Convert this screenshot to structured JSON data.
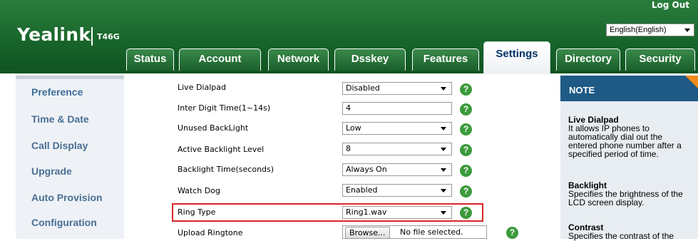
{
  "header": {
    "logo": "Yealink",
    "model": "T46G",
    "logout": "Log Out",
    "language": "English(English)"
  },
  "tabs": [
    "Status",
    "Account",
    "Network",
    "Dsskey",
    "Features",
    "Settings",
    "Directory",
    "Security"
  ],
  "active_tab": "Settings",
  "sidebar": {
    "items": [
      "Preference",
      "Time & Date",
      "Call Display",
      "Upgrade",
      "Auto Provision",
      "Configuration"
    ],
    "active": "Preference"
  },
  "settings": {
    "live_dialpad": {
      "label": "Live Dialpad",
      "value": "Disabled"
    },
    "inter_digit": {
      "label": "Inter Digit Time(1~14s)",
      "value": "4"
    },
    "unused_backlight": {
      "label": "Unused BackLight",
      "value": "Low"
    },
    "active_backlight": {
      "label": "Active Backlight Level",
      "value": "8"
    },
    "backlight_time": {
      "label": "Backlight Time(seconds)",
      "value": "Always On"
    },
    "watch_dog": {
      "label": "Watch Dog",
      "value": "Enabled"
    },
    "ring_type": {
      "label": "Ring Type",
      "value": "Ring1.wav"
    },
    "upload_ringtone": {
      "label": "Upload Ringtone",
      "button": "Browse...",
      "status": "No file selected."
    }
  },
  "help_glyph": "?",
  "note": {
    "title": "NOTE",
    "sections": [
      {
        "heading": "Live Dialpad",
        "lines": [
          "It allows IP phones to",
          "automatically dial out the",
          "entered phone number after a",
          "specified period of time."
        ]
      },
      {
        "heading": "Backlight",
        "lines": [
          "Specifies the brightness of the",
          "LCD screen display."
        ]
      },
      {
        "heading": "Contrast",
        "lines": [
          "Specifies the contrast of the"
        ]
      }
    ]
  },
  "colors": {
    "header_green": "#1a6a2e",
    "note_header": "#1e5a85",
    "highlight": "#d9252a",
    "help": "#3c9a3c"
  }
}
